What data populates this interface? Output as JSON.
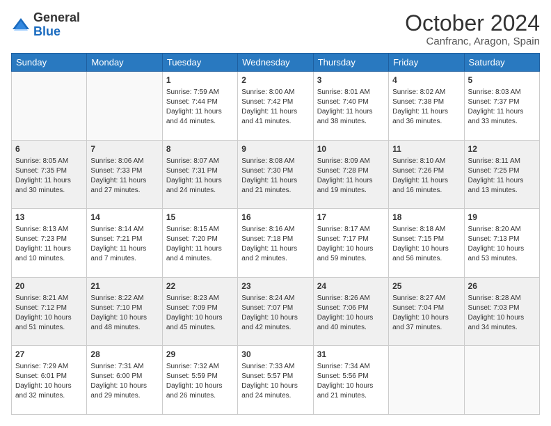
{
  "logo": {
    "general": "General",
    "blue": "Blue"
  },
  "title": "October 2024",
  "location": "Canfranc, Aragon, Spain",
  "days_of_week": [
    "Sunday",
    "Monday",
    "Tuesday",
    "Wednesday",
    "Thursday",
    "Friday",
    "Saturday"
  ],
  "weeks": [
    [
      {
        "day": "",
        "sunrise": "",
        "sunset": "",
        "daylight": ""
      },
      {
        "day": "",
        "sunrise": "",
        "sunset": "",
        "daylight": ""
      },
      {
        "day": "1",
        "sunrise": "Sunrise: 7:59 AM",
        "sunset": "Sunset: 7:44 PM",
        "daylight": "Daylight: 11 hours and 44 minutes."
      },
      {
        "day": "2",
        "sunrise": "Sunrise: 8:00 AM",
        "sunset": "Sunset: 7:42 PM",
        "daylight": "Daylight: 11 hours and 41 minutes."
      },
      {
        "day": "3",
        "sunrise": "Sunrise: 8:01 AM",
        "sunset": "Sunset: 7:40 PM",
        "daylight": "Daylight: 11 hours and 38 minutes."
      },
      {
        "day": "4",
        "sunrise": "Sunrise: 8:02 AM",
        "sunset": "Sunset: 7:38 PM",
        "daylight": "Daylight: 11 hours and 36 minutes."
      },
      {
        "day": "5",
        "sunrise": "Sunrise: 8:03 AM",
        "sunset": "Sunset: 7:37 PM",
        "daylight": "Daylight: 11 hours and 33 minutes."
      }
    ],
    [
      {
        "day": "6",
        "sunrise": "Sunrise: 8:05 AM",
        "sunset": "Sunset: 7:35 PM",
        "daylight": "Daylight: 11 hours and 30 minutes."
      },
      {
        "day": "7",
        "sunrise": "Sunrise: 8:06 AM",
        "sunset": "Sunset: 7:33 PM",
        "daylight": "Daylight: 11 hours and 27 minutes."
      },
      {
        "day": "8",
        "sunrise": "Sunrise: 8:07 AM",
        "sunset": "Sunset: 7:31 PM",
        "daylight": "Daylight: 11 hours and 24 minutes."
      },
      {
        "day": "9",
        "sunrise": "Sunrise: 8:08 AM",
        "sunset": "Sunset: 7:30 PM",
        "daylight": "Daylight: 11 hours and 21 minutes."
      },
      {
        "day": "10",
        "sunrise": "Sunrise: 8:09 AM",
        "sunset": "Sunset: 7:28 PM",
        "daylight": "Daylight: 11 hours and 19 minutes."
      },
      {
        "day": "11",
        "sunrise": "Sunrise: 8:10 AM",
        "sunset": "Sunset: 7:26 PM",
        "daylight": "Daylight: 11 hours and 16 minutes."
      },
      {
        "day": "12",
        "sunrise": "Sunrise: 8:11 AM",
        "sunset": "Sunset: 7:25 PM",
        "daylight": "Daylight: 11 hours and 13 minutes."
      }
    ],
    [
      {
        "day": "13",
        "sunrise": "Sunrise: 8:13 AM",
        "sunset": "Sunset: 7:23 PM",
        "daylight": "Daylight: 11 hours and 10 minutes."
      },
      {
        "day": "14",
        "sunrise": "Sunrise: 8:14 AM",
        "sunset": "Sunset: 7:21 PM",
        "daylight": "Daylight: 11 hours and 7 minutes."
      },
      {
        "day": "15",
        "sunrise": "Sunrise: 8:15 AM",
        "sunset": "Sunset: 7:20 PM",
        "daylight": "Daylight: 11 hours and 4 minutes."
      },
      {
        "day": "16",
        "sunrise": "Sunrise: 8:16 AM",
        "sunset": "Sunset: 7:18 PM",
        "daylight": "Daylight: 11 hours and 2 minutes."
      },
      {
        "day": "17",
        "sunrise": "Sunrise: 8:17 AM",
        "sunset": "Sunset: 7:17 PM",
        "daylight": "Daylight: 10 hours and 59 minutes."
      },
      {
        "day": "18",
        "sunrise": "Sunrise: 8:18 AM",
        "sunset": "Sunset: 7:15 PM",
        "daylight": "Daylight: 10 hours and 56 minutes."
      },
      {
        "day": "19",
        "sunrise": "Sunrise: 8:20 AM",
        "sunset": "Sunset: 7:13 PM",
        "daylight": "Daylight: 10 hours and 53 minutes."
      }
    ],
    [
      {
        "day": "20",
        "sunrise": "Sunrise: 8:21 AM",
        "sunset": "Sunset: 7:12 PM",
        "daylight": "Daylight: 10 hours and 51 minutes."
      },
      {
        "day": "21",
        "sunrise": "Sunrise: 8:22 AM",
        "sunset": "Sunset: 7:10 PM",
        "daylight": "Daylight: 10 hours and 48 minutes."
      },
      {
        "day": "22",
        "sunrise": "Sunrise: 8:23 AM",
        "sunset": "Sunset: 7:09 PM",
        "daylight": "Daylight: 10 hours and 45 minutes."
      },
      {
        "day": "23",
        "sunrise": "Sunrise: 8:24 AM",
        "sunset": "Sunset: 7:07 PM",
        "daylight": "Daylight: 10 hours and 42 minutes."
      },
      {
        "day": "24",
        "sunrise": "Sunrise: 8:26 AM",
        "sunset": "Sunset: 7:06 PM",
        "daylight": "Daylight: 10 hours and 40 minutes."
      },
      {
        "day": "25",
        "sunrise": "Sunrise: 8:27 AM",
        "sunset": "Sunset: 7:04 PM",
        "daylight": "Daylight: 10 hours and 37 minutes."
      },
      {
        "day": "26",
        "sunrise": "Sunrise: 8:28 AM",
        "sunset": "Sunset: 7:03 PM",
        "daylight": "Daylight: 10 hours and 34 minutes."
      }
    ],
    [
      {
        "day": "27",
        "sunrise": "Sunrise: 7:29 AM",
        "sunset": "Sunset: 6:01 PM",
        "daylight": "Daylight: 10 hours and 32 minutes."
      },
      {
        "day": "28",
        "sunrise": "Sunrise: 7:31 AM",
        "sunset": "Sunset: 6:00 PM",
        "daylight": "Daylight: 10 hours and 29 minutes."
      },
      {
        "day": "29",
        "sunrise": "Sunrise: 7:32 AM",
        "sunset": "Sunset: 5:59 PM",
        "daylight": "Daylight: 10 hours and 26 minutes."
      },
      {
        "day": "30",
        "sunrise": "Sunrise: 7:33 AM",
        "sunset": "Sunset: 5:57 PM",
        "daylight": "Daylight: 10 hours and 24 minutes."
      },
      {
        "day": "31",
        "sunrise": "Sunrise: 7:34 AM",
        "sunset": "Sunset: 5:56 PM",
        "daylight": "Daylight: 10 hours and 21 minutes."
      },
      {
        "day": "",
        "sunrise": "",
        "sunset": "",
        "daylight": ""
      },
      {
        "day": "",
        "sunrise": "",
        "sunset": "",
        "daylight": ""
      }
    ]
  ]
}
